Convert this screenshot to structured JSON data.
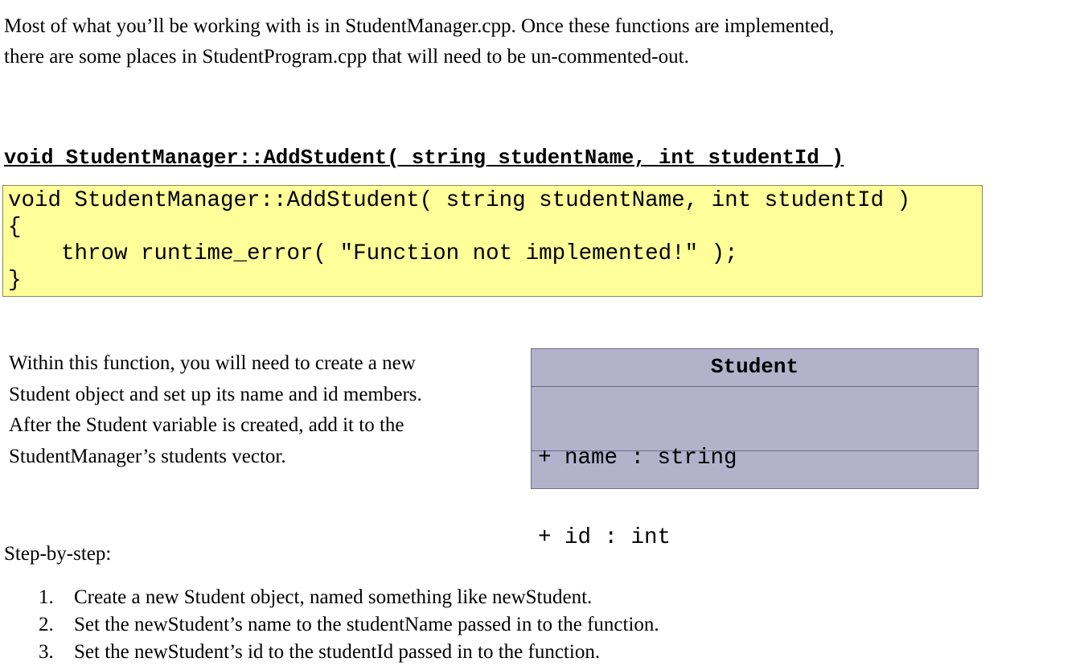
{
  "intro": {
    "line1": "Most of what you’ll be working with is in StudentManager.cpp. Once these functions are implemented,",
    "line2": "there are some places in StudentProgram.cpp that will need to be un-commented-out."
  },
  "heading": "void StudentManager::AddStudent( string studentName, int studentId )",
  "code": {
    "lines": [
      "void StudentManager::AddStudent( string studentName, int studentId )",
      "{",
      "    throw runtime_error( \"Function not implemented!\" );",
      "}"
    ],
    "background_color": "#ffff99"
  },
  "description": {
    "lines": [
      "Within this function, you will need to create a new",
      "Student object and set up its name and id members.",
      "After the Student variable is created, add it to the",
      "StudentManager’s students vector."
    ]
  },
  "uml": {
    "class_name": "Student",
    "attributes": [
      "+ name : string",
      "+ id : int"
    ],
    "background_color": "#b4b1cb"
  },
  "steps": {
    "label": "Step-by-step:",
    "items": [
      {
        "num": "1.",
        "text": "Create a new Student object, named something like newStudent."
      },
      {
        "num": "2.",
        "text": "Set the newStudent’s name to the studentName passed in to the function."
      },
      {
        "num": "3.",
        "text": "Set the newStudent’s id to the studentId passed in to the function."
      }
    ]
  }
}
